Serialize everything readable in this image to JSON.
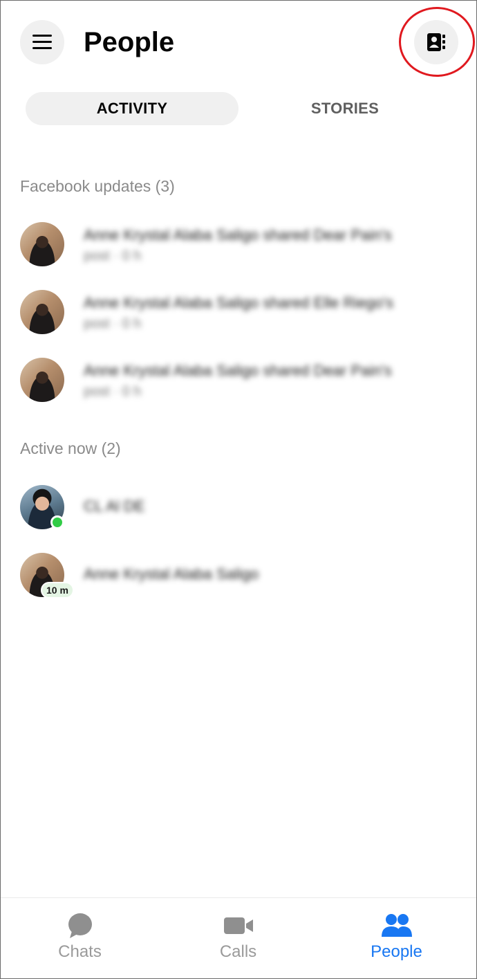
{
  "header": {
    "title": "People",
    "menu_icon": "hamburger-menu-icon",
    "contacts_icon": "contacts-book-icon"
  },
  "tabs": [
    {
      "label": "ACTIVITY",
      "selected": true
    },
    {
      "label": "STORIES",
      "selected": false
    }
  ],
  "facebook_updates": {
    "heading": "Facebook updates (3)",
    "items": [
      {
        "text": "Anne Krystal Alaba Saligo shared Dear Pain's",
        "sub": "post · 0 h"
      },
      {
        "text": "Anne Krystal Alaba Saligo shared Elle Riego's",
        "sub": "post · 0 h"
      },
      {
        "text": "Anne Krystal Alaba Saligo shared Dear Pain's",
        "sub": "post · 0 h"
      }
    ]
  },
  "active_now": {
    "heading": "Active now (2)",
    "items": [
      {
        "name": "CL Al DE",
        "status": "online"
      },
      {
        "name": "Anne Krystal Alaba Saligo",
        "status": "10 m"
      }
    ]
  },
  "bottom_nav": {
    "items": [
      {
        "label": "Chats",
        "icon": "chat-bubble-icon",
        "active": false
      },
      {
        "label": "Calls",
        "icon": "video-camera-icon",
        "active": false
      },
      {
        "label": "People",
        "icon": "people-icon",
        "active": true
      }
    ]
  },
  "colors": {
    "accent": "#1877f2",
    "online": "#31cc46",
    "annotation": "#e0191f"
  }
}
